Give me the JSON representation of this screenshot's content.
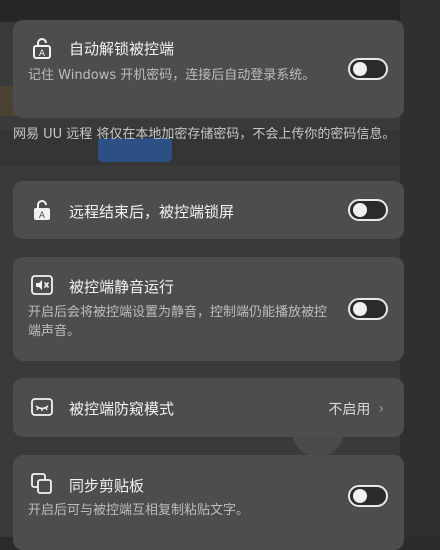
{
  "settings": {
    "auto_unlock": {
      "title": "自动解锁被控端",
      "desc": "记住 Windows 开机密码，连接后自动登录系统。",
      "icon": "lock-a-icon"
    },
    "password_hint": "网易 UU 远程 将仅在本地加密存储密码，不会上传你的密码信息。",
    "lock_after": {
      "title": "远程结束后，被控端锁屏",
      "icon": "lock-a-filled-icon"
    },
    "mute": {
      "title": "被控端静音运行",
      "desc": "开启后会将被控端设置为静音，控制端仍能播放被控端声音。",
      "icon": "speaker-mute-icon"
    },
    "privacy": {
      "title": "被控端防窥模式",
      "status": "不启用",
      "icon": "privacy-eye-icon"
    },
    "clipboard": {
      "title": "同步剪贴板",
      "desc": "开启后可与被控端互相复制粘贴文字。",
      "icon": "copy-icon"
    }
  }
}
